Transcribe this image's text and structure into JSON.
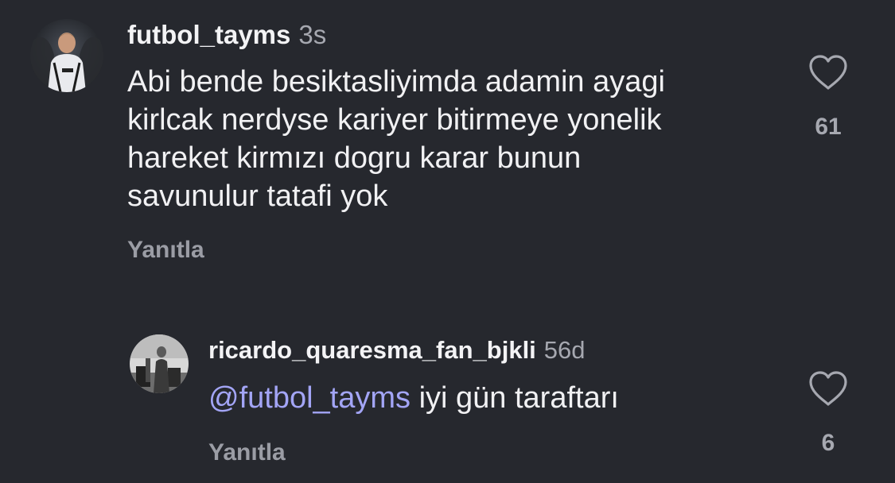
{
  "comment": {
    "username": "futbol_tayms",
    "time": "3s",
    "text_lines": [
      "Abi bende besiktasliyimda adamin ayagi",
      "kirlcak nerdyse kariyer bitirmeye yonelik",
      "hareket kirmızı dogru karar bunun",
      "savunulur tatafi yok"
    ],
    "reply_label": "Yanıtla",
    "like_icon": "heart-outline-icon",
    "like_count": "61"
  },
  "reply": {
    "username": "ricardo_quaresma_fan_bjkli",
    "time": "56d",
    "mention": "@futbol_tayms",
    "text": " iyi gün taraftarı",
    "reply_label": "Yanıtla",
    "like_icon": "heart-outline-icon",
    "like_count": "6"
  },
  "colors": {
    "background": "#26282e",
    "mention": "#a3a5f6",
    "secondary_text": "#a6a8b0"
  }
}
